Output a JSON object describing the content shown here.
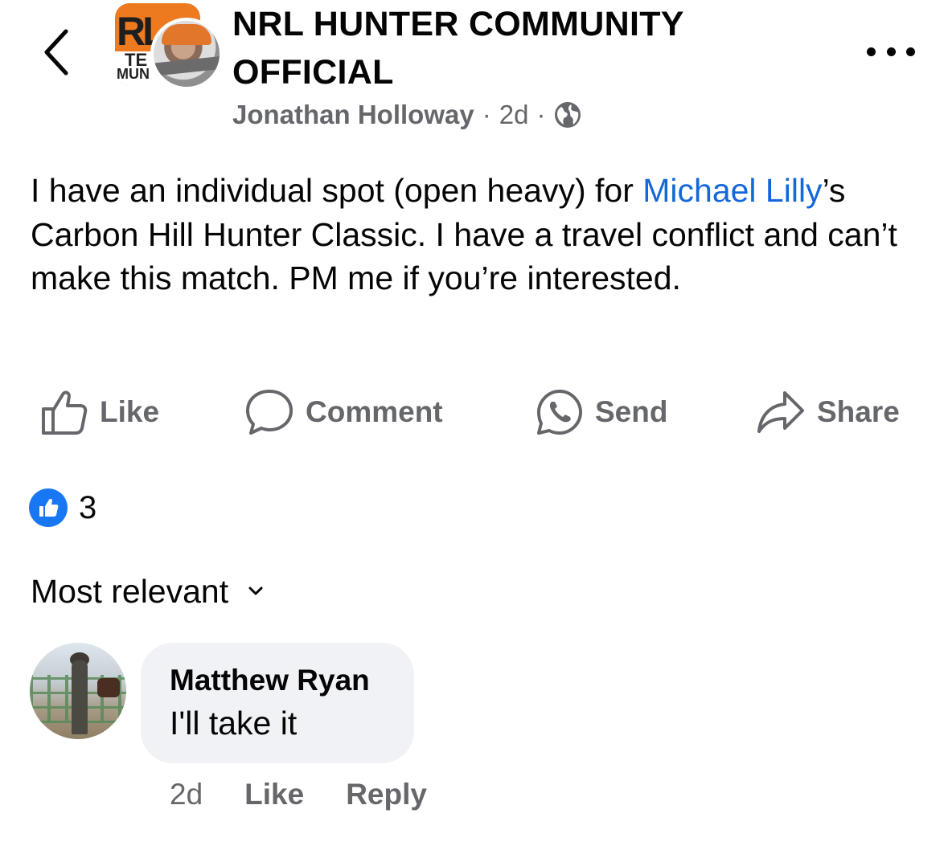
{
  "header": {
    "group_name": "NRL HUNTER COMMUNITY OFFICIAL",
    "author": "Jonathan Holloway",
    "separator": "·",
    "time": "2d",
    "privacy_icon": "globe-icon",
    "back_icon": "chevron-left-icon",
    "more_icon": "more-horizontal-icon",
    "avatar_logo_text": "RL",
    "avatar_logo_te": "TE",
    "avatar_logo_mun": "MUN"
  },
  "post": {
    "text_before_mention": "I have an individual spot (open heavy) for ",
    "mention": "Michael Lilly",
    "text_after_mention": "’s Carbon Hill Hunter Classic.  I have a travel conflict and can’t make this match.  PM me if you’re interested."
  },
  "actions": {
    "like": "Like",
    "comment": "Comment",
    "send": "Send",
    "share": "Share"
  },
  "reactions": {
    "count": "3",
    "icon": "thumbs-up-icon",
    "color": "#1877f2"
  },
  "comments_sort": {
    "label": "Most relevant"
  },
  "comments": [
    {
      "author": "Matthew Ryan",
      "text": "I'll take it",
      "time": "2d",
      "like": "Like",
      "reply": "Reply"
    }
  ],
  "colors": {
    "mention": "#1467d9",
    "secondary_text": "#65676b",
    "bubble": "#f0f2f5"
  }
}
